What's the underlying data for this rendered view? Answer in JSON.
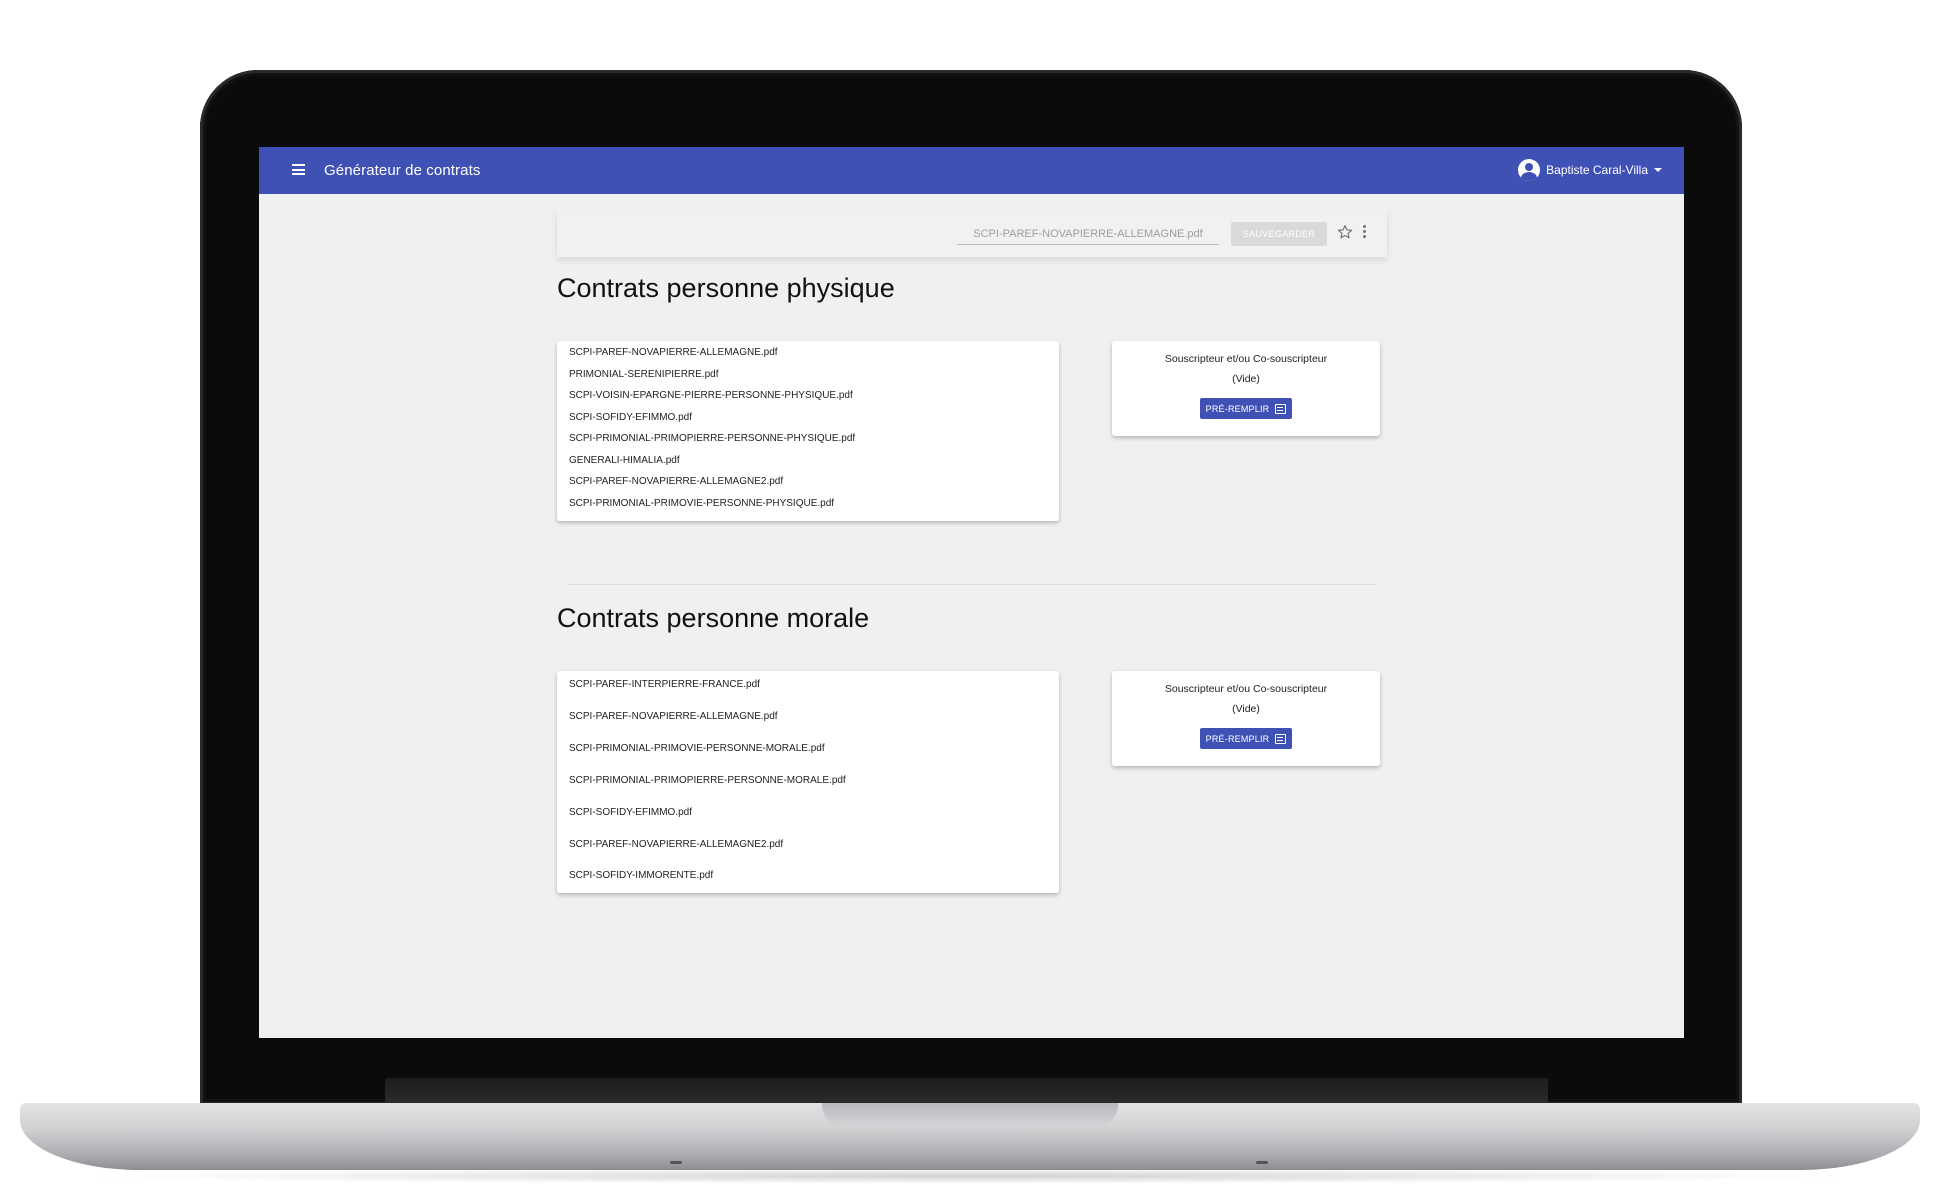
{
  "app": {
    "title": "Générateur de contrats",
    "user_name": "Baptiste Caral-Villa",
    "accent_color": "#3f51b5"
  },
  "toolbar": {
    "file_name": "SCPI-PAREF-NOVAPIERRE-ALLEMAGNE.pdf",
    "save_label": "SAUVEGARDER",
    "icons": [
      "star-outline-icon",
      "more-vert-icon"
    ]
  },
  "physique": {
    "title": "Contrats personne physique",
    "files": [
      "SCPI-PAREF-NOVAPIERRE-ALLEMAGNE.pdf",
      "PRIMONIAL-SERENIPIERRE.pdf",
      "SCPI-VOISIN-EPARGNE-PIERRE-PERSONNE-PHYSIQUE.pdf",
      "SCPI-SOFIDY-EFIMMO.pdf",
      "SCPI-PRIMONIAL-PRIMOPIERRE-PERSONNE-PHYSIQUE.pdf",
      "GENERALI-HIMALIA.pdf",
      "SCPI-PAREF-NOVAPIERRE-ALLEMAGNE2.pdf",
      "SCPI-PRIMONIAL-PRIMOVIE-PERSONNE-PHYSIQUE.pdf"
    ],
    "prefill": {
      "title": "Souscripteur et/ou Co-souscripteur",
      "status": "(Vide)",
      "button_label": "PRÉ-REMPLIR"
    }
  },
  "morale": {
    "title": "Contrats personne morale",
    "files": [
      "SCPI-PAREF-INTERPIERRE-FRANCE.pdf",
      "SCPI-PAREF-NOVAPIERRE-ALLEMAGNE.pdf",
      "SCPI-PRIMONIAL-PRIMOVIE-PERSONNE-MORALE.pdf",
      "SCPI-PRIMONIAL-PRIMOPIERRE-PERSONNE-MORALE.pdf",
      "SCPI-SOFIDY-EFIMMO.pdf",
      "SCPI-PAREF-NOVAPIERRE-ALLEMAGNE2.pdf",
      "SCPI-SOFIDY-IMMORENTE.pdf"
    ],
    "prefill": {
      "title": "Souscripteur et/ou Co-souscripteur",
      "status": "(Vide)",
      "button_label": "PRÉ-REMPLIR"
    }
  }
}
